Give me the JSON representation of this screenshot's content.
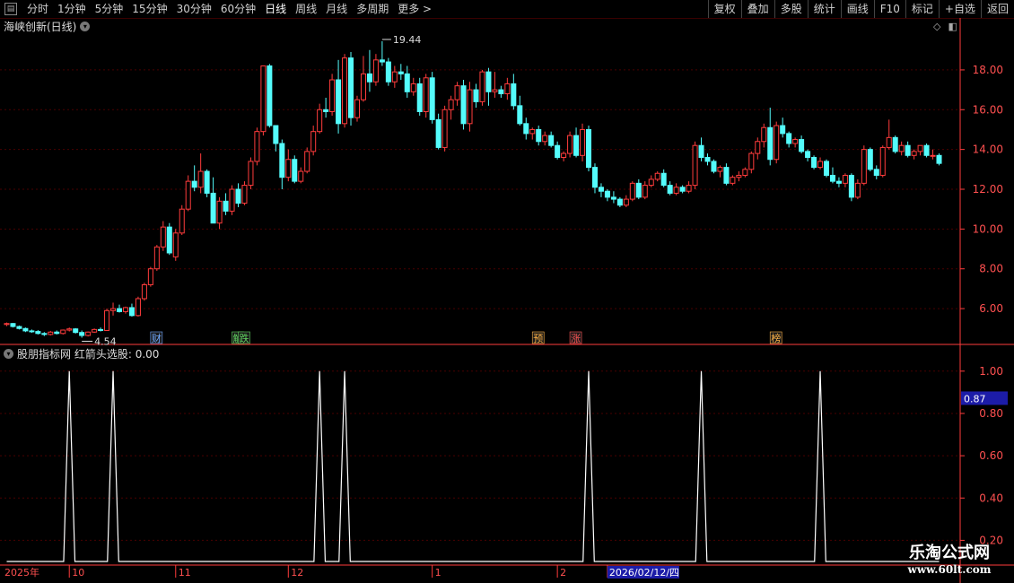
{
  "toolbar": {
    "periods": [
      "分时",
      "1分钟",
      "5分钟",
      "15分钟",
      "30分钟",
      "60分钟",
      "日线",
      "周线",
      "月线",
      "多周期",
      "更多 >"
    ],
    "active_period": "日线",
    "right_buttons": [
      "复权",
      "叠加",
      "多股",
      "统计",
      "画线",
      "F10",
      "标记",
      "+自选",
      "返回"
    ]
  },
  "stock": {
    "title": "海峡创新(日线)"
  },
  "indicator": {
    "title": "股朋指标网",
    "label": "红箭头选股: 0.00"
  },
  "markers": [
    {
      "label": "财",
      "color": "#6fa8ff",
      "idx": 24
    },
    {
      "label": "解",
      "color": "#5fd35f",
      "idx": 37
    },
    {
      "label": "跌",
      "color": "#5fd35f",
      "idx": 38
    },
    {
      "label": "预",
      "color": "#ffb347",
      "idx": 85
    },
    {
      "label": "涨",
      "color": "#ff5555",
      "idx": 91
    },
    {
      "label": "榜",
      "color": "#ffb347",
      "idx": 123
    }
  ],
  "watermark": {
    "line1": "乐淘公式网",
    "line2": "www.60lt.com"
  },
  "colors": {
    "up": "#ff3c3c",
    "down": "#54fcfc",
    "grid": "#4a0000",
    "axis": "#ff3c3c",
    "line": "#ffffff"
  },
  "chart_data": [
    {
      "type": "candlestick",
      "title": "海峡创新(日线)",
      "ylim": [
        4.2,
        19.8
      ],
      "y_ticks": [
        6.0,
        8.0,
        10.0,
        12.0,
        14.0,
        16.0,
        18.0
      ],
      "grid": true,
      "max_label": "19.44",
      "min_label": "4.54",
      "x_ticks": [
        {
          "label": "2025年",
          "idx": 0
        },
        {
          "label": "10",
          "idx": 10
        },
        {
          "label": "11",
          "idx": 27
        },
        {
          "label": "12",
          "idx": 45
        },
        {
          "label": "1",
          "idx": 68
        },
        {
          "label": "2",
          "idx": 88
        },
        {
          "label": "2026/02/12/四",
          "idx": 96,
          "highlight": true
        }
      ],
      "ohlc": [
        [
          5.2,
          5.3,
          5.12,
          5.25
        ],
        [
          5.25,
          5.28,
          5.05,
          5.1
        ],
        [
          5.1,
          5.15,
          4.95,
          5.0
        ],
        [
          5.0,
          5.05,
          4.82,
          4.88
        ],
        [
          4.88,
          4.95,
          4.78,
          4.85
        ],
        [
          4.85,
          4.92,
          4.7,
          4.75
        ],
        [
          4.75,
          4.82,
          4.62,
          4.7
        ],
        [
          4.7,
          4.88,
          4.65,
          4.82
        ],
        [
          4.82,
          4.9,
          4.7,
          4.75
        ],
        [
          4.75,
          4.95,
          4.7,
          4.92
        ],
        [
          4.92,
          5.05,
          4.85,
          4.98
        ],
        [
          4.98,
          5.02,
          4.75,
          4.8
        ],
        [
          4.8,
          4.9,
          4.54,
          4.65
        ],
        [
          4.65,
          4.85,
          4.6,
          4.82
        ],
        [
          4.82,
          5.0,
          4.78,
          4.95
        ],
        [
          4.95,
          5.05,
          4.85,
          4.9
        ],
        [
          4.9,
          6.0,
          4.88,
          5.9
        ],
        [
          5.9,
          6.3,
          5.65,
          6.0
        ],
        [
          6.0,
          6.2,
          5.8,
          5.85
        ],
        [
          5.85,
          6.1,
          5.75,
          6.05
        ],
        [
          6.05,
          6.25,
          5.6,
          5.65
        ],
        [
          5.65,
          6.6,
          5.6,
          6.5
        ],
        [
          6.5,
          7.3,
          6.4,
          7.2
        ],
        [
          7.2,
          8.1,
          7.1,
          8.0
        ],
        [
          8.0,
          9.2,
          7.9,
          9.1
        ],
        [
          9.1,
          10.4,
          8.9,
          10.1
        ],
        [
          10.1,
          10.3,
          8.7,
          8.8
        ],
        [
          8.6,
          10.0,
          8.4,
          9.8
        ],
        [
          9.8,
          11.2,
          9.7,
          11.0
        ],
        [
          11.0,
          12.7,
          10.9,
          12.4
        ],
        [
          12.4,
          13.2,
          11.9,
          12.1
        ],
        [
          12.1,
          13.8,
          11.8,
          12.9
        ],
        [
          12.9,
          13.0,
          11.6,
          11.8
        ],
        [
          11.8,
          12.6,
          10.9,
          10.3
        ],
        [
          10.3,
          11.6,
          10.0,
          11.4
        ],
        [
          11.4,
          11.8,
          10.7,
          10.9
        ],
        [
          10.9,
          12.2,
          10.7,
          12.0
        ],
        [
          12.0,
          12.3,
          11.1,
          11.3
        ],
        [
          11.3,
          12.4,
          11.2,
          12.2
        ],
        [
          12.2,
          13.6,
          12.0,
          13.4
        ],
        [
          13.4,
          15.1,
          13.2,
          14.9
        ],
        [
          14.9,
          17.7,
          14.7,
          18.2
        ],
        [
          18.2,
          18.3,
          15.1,
          15.2
        ],
        [
          15.2,
          14.8,
          13.9,
          14.3
        ],
        [
          14.3,
          14.5,
          12.0,
          12.6
        ],
        [
          12.6,
          14.0,
          12.4,
          13.5
        ],
        [
          13.5,
          13.7,
          12.3,
          12.4
        ],
        [
          12.4,
          13.1,
          12.3,
          12.9
        ],
        [
          12.9,
          14.1,
          12.8,
          13.9
        ],
        [
          13.9,
          15.2,
          13.7,
          14.9
        ],
        [
          14.9,
          16.3,
          14.8,
          16.0
        ],
        [
          16.0,
          16.6,
          15.6,
          15.9
        ],
        [
          15.9,
          17.8,
          15.7,
          17.5
        ],
        [
          17.5,
          18.5,
          14.8,
          15.3
        ],
        [
          15.3,
          18.8,
          15.1,
          18.6
        ],
        [
          18.6,
          18.9,
          15.2,
          15.6
        ],
        [
          15.6,
          16.7,
          15.4,
          16.5
        ],
        [
          16.5,
          18.7,
          16.4,
          17.8
        ],
        [
          17.8,
          19.0,
          16.9,
          17.4
        ],
        [
          17.4,
          18.8,
          17.2,
          18.5
        ],
        [
          18.5,
          19.44,
          18.2,
          18.4
        ],
        [
          18.4,
          18.6,
          17.2,
          17.4
        ],
        [
          17.4,
          18.2,
          17.1,
          17.9
        ],
        [
          17.9,
          18.3,
          17.5,
          17.8
        ],
        [
          17.8,
          18.2,
          16.6,
          16.9
        ],
        [
          16.9,
          17.6,
          16.7,
          17.3
        ],
        [
          17.3,
          17.6,
          15.7,
          15.9
        ],
        [
          15.9,
          17.8,
          15.6,
          17.6
        ],
        [
          17.6,
          17.9,
          15.3,
          15.5
        ],
        [
          15.5,
          15.8,
          14.0,
          14.1
        ],
        [
          14.1,
          16.2,
          13.9,
          16.0
        ],
        [
          16.0,
          16.7,
          15.5,
          16.5
        ],
        [
          16.5,
          17.4,
          16.2,
          17.2
        ],
        [
          17.2,
          17.5,
          15.0,
          15.3
        ],
        [
          15.3,
          17.4,
          14.9,
          17.0
        ],
        [
          17.0,
          17.3,
          16.1,
          16.4
        ],
        [
          16.4,
          18.0,
          16.2,
          17.9
        ],
        [
          17.9,
          18.1,
          16.2,
          16.9
        ],
        [
          16.9,
          17.9,
          16.6,
          17.0
        ],
        [
          17.0,
          17.2,
          16.6,
          16.8
        ],
        [
          16.8,
          17.6,
          16.5,
          17.3
        ],
        [
          17.3,
          17.8,
          16.0,
          16.2
        ],
        [
          16.2,
          16.7,
          15.2,
          15.3
        ],
        [
          15.3,
          15.6,
          14.5,
          14.8
        ],
        [
          14.8,
          15.1,
          14.5,
          15.0
        ],
        [
          15.0,
          15.2,
          14.2,
          14.4
        ],
        [
          14.4,
          14.9,
          14.2,
          14.7
        ],
        [
          14.7,
          14.9,
          14.1,
          14.2
        ],
        [
          14.2,
          14.4,
          13.5,
          13.6
        ],
        [
          13.6,
          13.9,
          13.4,
          13.8
        ],
        [
          13.8,
          14.9,
          13.6,
          14.7
        ],
        [
          14.7,
          15.1,
          13.6,
          13.7
        ],
        [
          13.7,
          15.3,
          13.4,
          15.0
        ],
        [
          15.0,
          15.2,
          12.9,
          13.1
        ],
        [
          13.1,
          13.3,
          11.8,
          12.1
        ],
        [
          12.1,
          12.3,
          11.6,
          11.9
        ],
        [
          11.9,
          12.0,
          11.4,
          11.6
        ],
        [
          11.6,
          11.9,
          11.3,
          11.5
        ],
        [
          11.5,
          11.6,
          11.1,
          11.2
        ],
        [
          11.2,
          11.7,
          11.1,
          11.5
        ],
        [
          11.5,
          12.4,
          11.4,
          12.3
        ],
        [
          12.3,
          12.5,
          11.5,
          11.6
        ],
        [
          11.6,
          12.4,
          11.5,
          12.2
        ],
        [
          12.2,
          12.7,
          12.1,
          12.5
        ],
        [
          12.5,
          12.9,
          12.4,
          12.8
        ],
        [
          12.8,
          13.0,
          12.1,
          12.2
        ],
        [
          12.2,
          12.4,
          11.7,
          11.8
        ],
        [
          11.8,
          12.3,
          11.7,
          12.1
        ],
        [
          12.1,
          12.2,
          11.8,
          11.9
        ],
        [
          11.9,
          12.4,
          11.8,
          12.2
        ],
        [
          12.2,
          14.4,
          12.0,
          14.2
        ],
        [
          14.2,
          14.6,
          13.4,
          13.6
        ]
      ],
      "ohlc_late": [
        [
          13.6,
          13.8,
          13.2,
          13.4
        ],
        [
          13.4,
          13.5,
          12.8,
          12.9
        ],
        [
          12.9,
          13.2,
          12.6,
          13.1
        ],
        [
          13.1,
          13.3,
          12.2,
          12.3
        ],
        [
          12.3,
          12.7,
          12.2,
          12.6
        ],
        [
          12.6,
          12.9,
          12.4,
          12.7
        ],
        [
          12.7,
          13.1,
          12.6,
          13.0
        ],
        [
          13.0,
          13.9,
          12.8,
          13.8
        ],
        [
          13.8,
          14.6,
          13.5,
          14.4
        ],
        [
          14.4,
          15.3,
          14.1,
          15.1
        ],
        [
          15.1,
          16.1,
          13.2,
          13.5
        ],
        [
          13.5,
          15.4,
          13.3,
          15.2
        ],
        [
          15.2,
          15.6,
          14.6,
          14.8
        ],
        [
          14.8,
          14.9,
          14.1,
          14.3
        ],
        [
          14.3,
          14.6,
          14.1,
          14.5
        ],
        [
          14.5,
          14.7,
          13.8,
          13.9
        ],
        [
          13.9,
          14.0,
          13.4,
          13.6
        ],
        [
          13.6,
          13.7,
          13.0,
          13.1
        ],
        [
          13.1,
          13.6,
          13.0,
          13.4
        ],
        [
          13.4,
          13.5,
          12.6,
          12.7
        ],
        [
          12.7,
          13.1,
          12.3,
          12.4
        ],
        [
          12.4,
          12.6,
          12.1,
          12.3
        ],
        [
          12.3,
          12.8,
          12.1,
          12.7
        ],
        [
          12.7,
          12.8,
          11.4,
          11.6
        ],
        [
          11.6,
          12.5,
          11.5,
          12.3
        ],
        [
          12.3,
          14.2,
          12.2,
          14.0
        ],
        [
          14.0,
          14.1,
          12.9,
          13.0
        ],
        [
          13.0,
          13.2,
          12.5,
          12.7
        ],
        [
          12.7,
          14.2,
          12.6,
          14.1
        ],
        [
          14.1,
          15.5,
          14.0,
          14.6
        ],
        [
          14.6,
          14.7,
          13.8,
          13.9
        ],
        [
          13.9,
          14.4,
          13.7,
          14.2
        ],
        [
          14.2,
          14.4,
          13.6,
          13.7
        ],
        [
          13.7,
          14.0,
          13.5,
          13.9
        ],
        [
          13.9,
          14.2,
          13.7,
          14.2
        ],
        [
          14.2,
          14.3,
          13.6,
          13.7
        ],
        [
          13.7,
          14.0,
          13.5,
          13.7
        ],
        [
          13.7,
          13.8,
          13.2,
          13.3
        ]
      ]
    },
    {
      "type": "line",
      "title": "红箭头选股",
      "ylim": [
        0.1,
        1.05
      ],
      "y_ticks": [
        0.2,
        0.4,
        0.6,
        0.8,
        1.0
      ],
      "current_value": "0.87",
      "spike_idx": [
        10,
        17,
        50,
        54,
        93,
        111,
        130
      ]
    }
  ]
}
